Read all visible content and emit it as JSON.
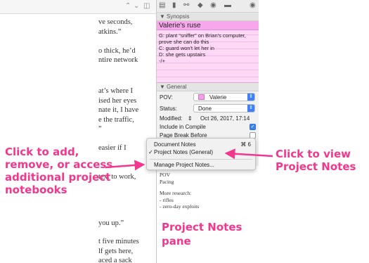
{
  "editor": {
    "toolbar_icons": [
      "chevron-up-icon",
      "chevron-down-icon",
      "split-view-icon"
    ],
    "lines": [
      "ve seconds,",
      "atkins.”",
      "o thick, he’d",
      "ntire network",
      "at’s where I",
      "ised her eyes",
      "nate it, I have",
      "e the traffic,",
      "”",
      "easier if I",
      "text to work,",
      "you up.”",
      "t five minutes",
      "lf gets here,",
      "aced a sack"
    ]
  },
  "inspector": {
    "toolbar_icons": [
      "notes-icon",
      "bookmark-icon",
      "key-icon",
      "tag-icon",
      "snapshot-icon",
      "comment-icon",
      "lock-icon"
    ],
    "synopsis": {
      "header": "Synopsis",
      "title": "Valerie's ruse",
      "lines": [
        "G: plant “sniffer” on Brian's computer,",
        "prove she can do this",
        "C: guard won't let her in",
        "D: she gets upstairs",
        "-/+"
      ]
    },
    "general": {
      "header": "General",
      "pov_label": "POV:",
      "pov_value": "Valerie",
      "pov_color": "#f2a0ea",
      "status_label": "Status:",
      "status_value": "Done",
      "modified_label": "Modified:",
      "modified_value": "Oct 26, 2017, 17:14",
      "include_label": "Include in Compile",
      "include_checked": true,
      "pagebreak_label": "Page Break Before",
      "pagebreak_checked": false
    },
    "notes": {
      "lines": [
        "POV",
        "Pacing",
        "More research:",
        "- rifles",
        "- zero-day exploits"
      ]
    }
  },
  "menu": {
    "items": [
      {
        "label": "Document Notes",
        "shortcut": "⌘ 6",
        "checked": false
      },
      {
        "label": "Project Notes (General)",
        "shortcut": "",
        "checked": true
      },
      {
        "label": "Manage Project Notes...",
        "shortcut": "",
        "checked": false
      }
    ]
  },
  "annotations": {
    "left_callout": [
      "Click to add,",
      "remove, or access",
      "additional project",
      "notebooks"
    ],
    "right_callout": [
      "Click to view",
      "Project Notes"
    ],
    "pane_callout": [
      "Project Notes",
      "pane"
    ],
    "accent_color": "#f2378c"
  }
}
